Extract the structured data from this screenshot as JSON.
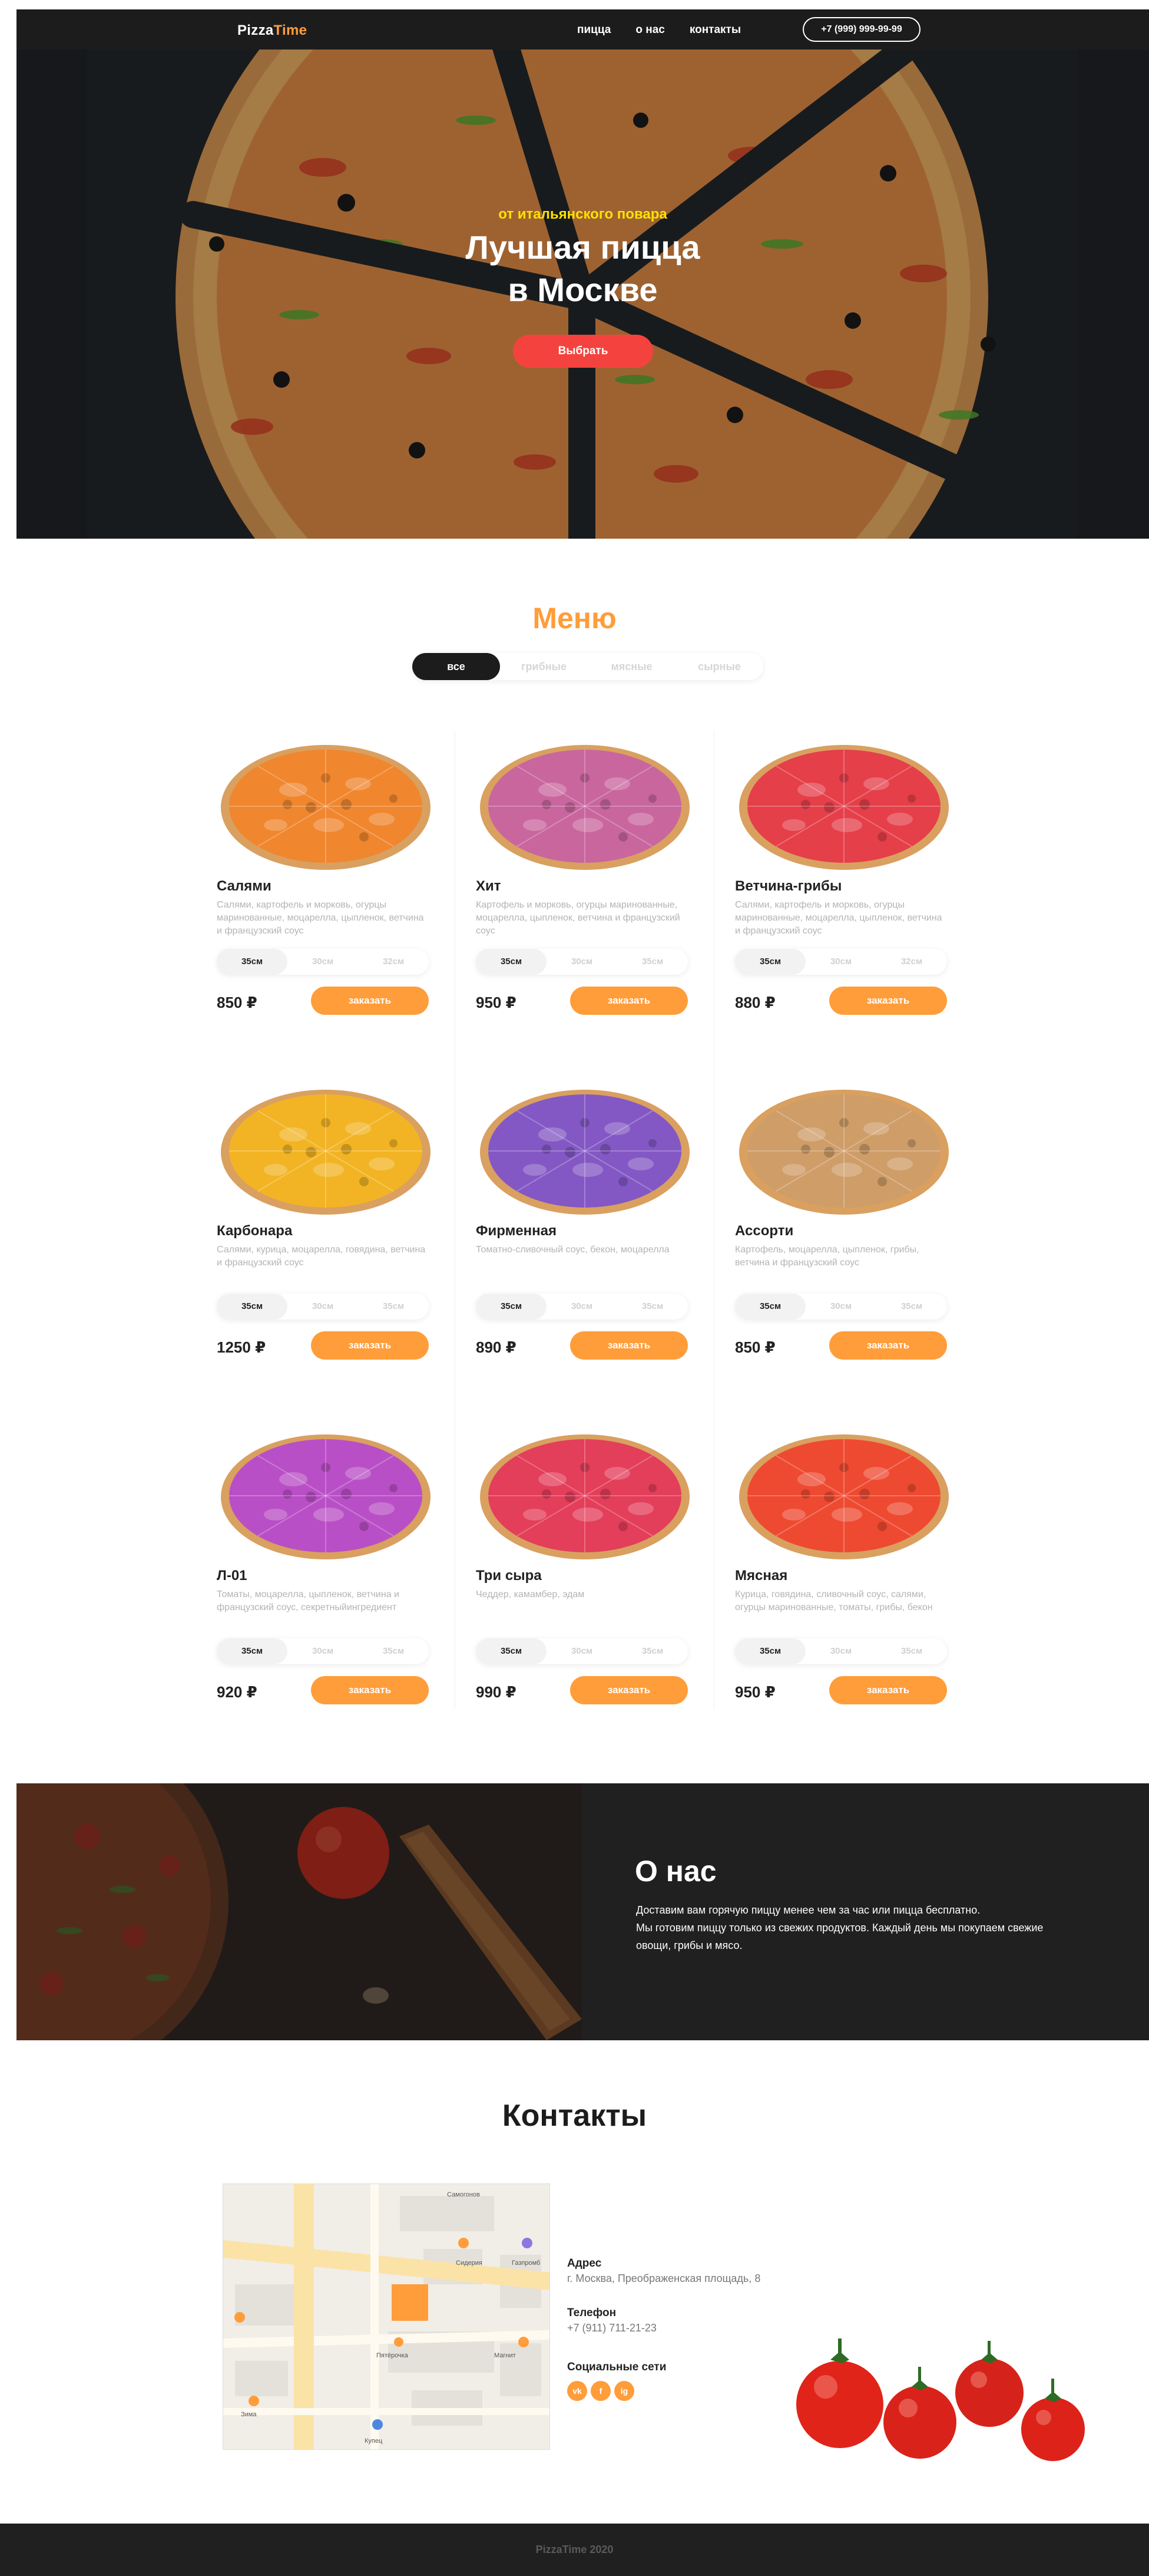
{
  "header": {
    "logo_part1": "Pizza",
    "logo_part2": "Time",
    "nav": [
      "пицца",
      "о нас",
      "контакты"
    ],
    "phone": "+7 (999) 999-99-99"
  },
  "hero": {
    "subtitle": "от итальянского повара",
    "title_line1": "Лучшая пицца",
    "title_line2": "в Москве",
    "button": "Выбрать"
  },
  "menu": {
    "title": "Меню",
    "filters": [
      "все",
      "грибные",
      "мясные",
      "сырные"
    ],
    "active_filter": "все",
    "order_label": "заказать",
    "items": [
      {
        "name": "Салями",
        "desc": "Салями, картофель и морковь, огурцы маринованные, моцарелла, цыпленок, ветчина и французский соус",
        "sizes": [
          "35см",
          "30см",
          "32см"
        ],
        "price": "850 ₽",
        "color": "#f0862e"
      },
      {
        "name": "Хит",
        "desc": "Картофель и морковь, огурцы маринованные, моцарелла, цыпленок, ветчина и французский соус",
        "sizes": [
          "35см",
          "30см",
          "35см"
        ],
        "price": "950 ₽",
        "color": "#c9669e"
      },
      {
        "name": "Ветчина-грибы",
        "desc": "Салями, картофель и морковь, огурцы маринованные, моцарелла, цыпленок, ветчина и французский соус",
        "sizes": [
          "35см",
          "30см",
          "32см"
        ],
        "price": "880 ₽",
        "color": "#e53f4a"
      },
      {
        "name": "Карбонара",
        "desc": "Салями, курица, моцарелла, говядина, ветчина и французский соус",
        "sizes": [
          "35см",
          "30см",
          "35см"
        ],
        "price": "1250 ₽",
        "color": "#f2b424"
      },
      {
        "name": "Фирменная",
        "desc": "Томатно-сливочный соус, бекон, моцарелла",
        "sizes": [
          "35см",
          "30см",
          "35см"
        ],
        "price": "890 ₽",
        "color": "#8358c4"
      },
      {
        "name": "Ассорти",
        "desc": "Картофель, моцарелла, цыпленок, грибы, ветчина и французский соус",
        "sizes": [
          "35см",
          "30см",
          "35см"
        ],
        "price": "850 ₽",
        "color": "#cf9d68"
      },
      {
        "name": "Л-01",
        "desc": "Томаты, моцарелла, цыпленок, ветчина и французский соус, секретныйингредиент",
        "sizes": [
          "35см",
          "30см",
          "35см"
        ],
        "price": "920 ₽",
        "color": "#b94fc6"
      },
      {
        "name": "Три сыра",
        "desc": "Чеддер, камамбер, эдам",
        "sizes": [
          "35см",
          "30см",
          "35см"
        ],
        "price": "990 ₽",
        "color": "#e33e5a"
      },
      {
        "name": "Мясная",
        "desc": "Курица, говядина, сливочный соус, салями, огурцы маринованные, томаты, грибы, бекон",
        "sizes": [
          "35см",
          "30см",
          "35см"
        ],
        "price": "950 ₽",
        "color": "#ee4a31"
      }
    ]
  },
  "about": {
    "title": "О нас",
    "line1": "Доставим вам горячую пиццу менее чем за час или пицца бесплатно.",
    "line2": "Мы готовим пиццу только из свежих продуктов. Каждый день мы покупаем свежие овощи, грибы и мясо."
  },
  "contacts": {
    "title": "Контакты",
    "address_label": "Адрес",
    "address": "г. Москва, Преображенская площадь, 8",
    "phone_label": "Телефон",
    "phone": "+7 (911) 711-21-23",
    "social_label": "Социальные сети",
    "socials": [
      "vk",
      "f",
      "ig"
    ]
  },
  "map": {
    "labels": [
      "Самогонов",
      "Сидерия",
      "Газпромб",
      "Пятёрочка",
      "Магнит",
      "Купец",
      "Зима"
    ]
  },
  "footer": {
    "text": "PizzaTime 2020"
  }
}
